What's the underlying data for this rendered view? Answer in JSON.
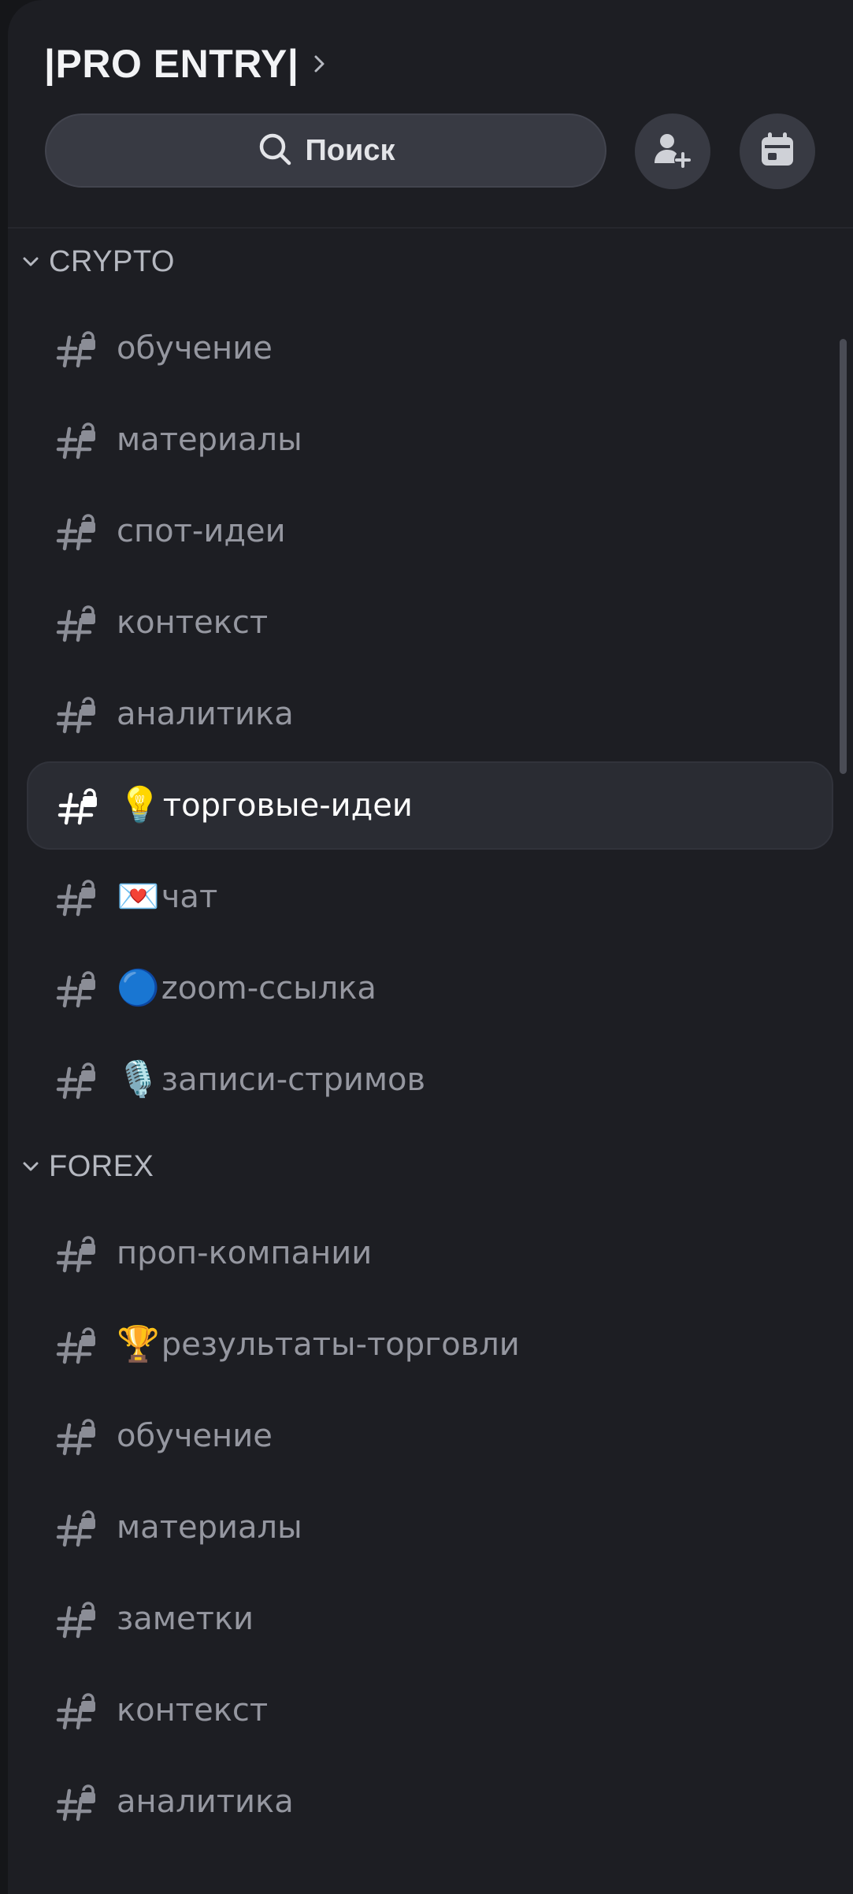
{
  "header": {
    "server_name": "|PRO ENTRY|",
    "search_label": "Поиск"
  },
  "icons": {
    "server_chevron": "chevron-right-icon",
    "search": "search-icon",
    "invite": "add-member-icon",
    "events": "calendar-icon",
    "channel": "locked-hashtag-icon"
  },
  "categories": [
    {
      "label": "CRYPTO",
      "channels": [
        {
          "emoji": "",
          "name": "обучение"
        },
        {
          "emoji": "",
          "name": "материалы"
        },
        {
          "emoji": "",
          "name": "спот-идеи"
        },
        {
          "emoji": "",
          "name": "контекст"
        },
        {
          "emoji": "",
          "name": "аналитика"
        },
        {
          "emoji": "💡",
          "name": "торговые-идеи",
          "selected": true
        },
        {
          "emoji": "💌",
          "name": "чат"
        },
        {
          "emoji": "🔵",
          "name": "zoom-ссылка"
        },
        {
          "emoji": "🎙️",
          "name": "записи-стримов"
        }
      ]
    },
    {
      "label": "FOREX",
      "channels": [
        {
          "emoji": "",
          "name": "проп-компании"
        },
        {
          "emoji": "🏆",
          "name": "результаты-торговли"
        },
        {
          "emoji": "",
          "name": "обучение"
        },
        {
          "emoji": "",
          "name": "материалы"
        },
        {
          "emoji": "",
          "name": "заметки"
        },
        {
          "emoji": "",
          "name": "контекст"
        },
        {
          "emoji": "",
          "name": "аналитика"
        }
      ]
    }
  ],
  "colors": {
    "background": "#1d1e23",
    "selected_row": "#2a2c33",
    "channel_text": "#9597a0",
    "selected_text": "#ffffff"
  }
}
